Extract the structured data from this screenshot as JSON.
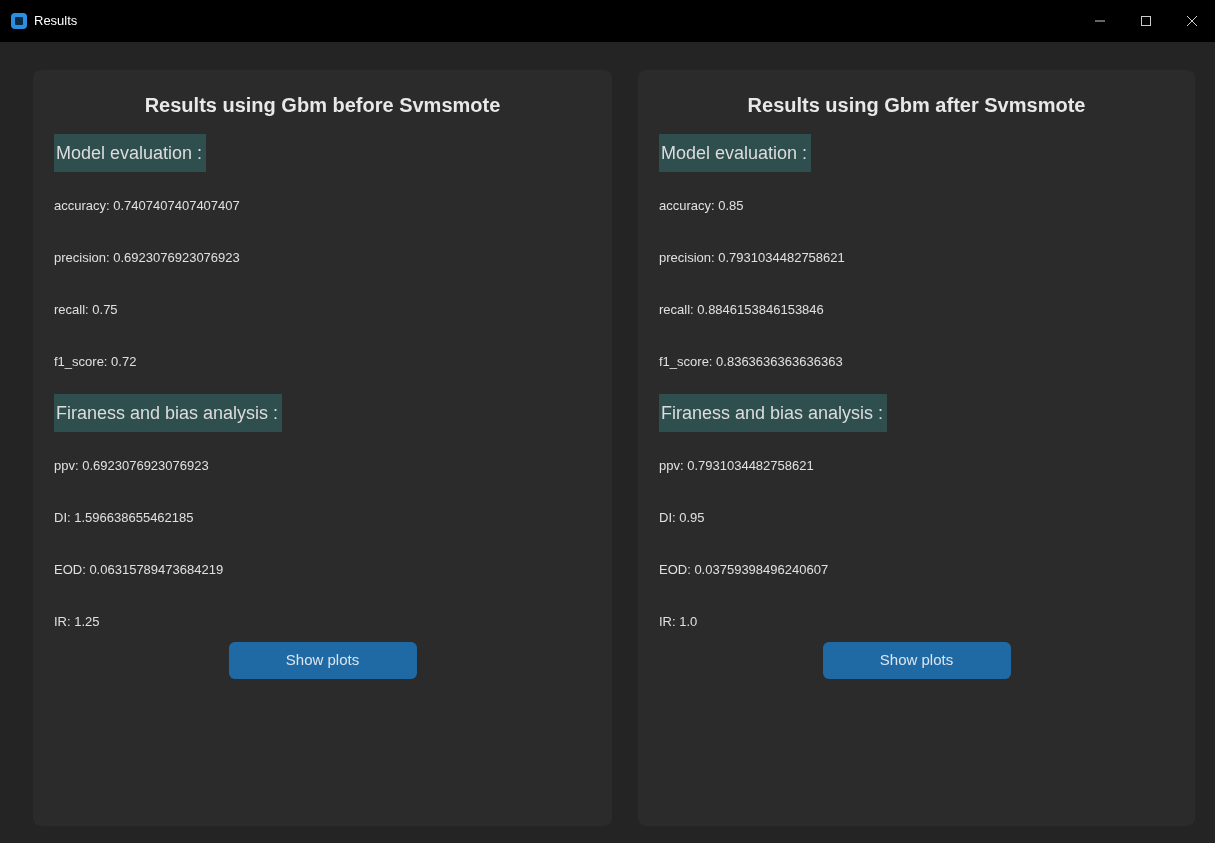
{
  "window": {
    "title": "Results"
  },
  "panels": [
    {
      "heading": "Results using Gbm before Svmsmote",
      "sections": [
        {
          "title": "Model evaluation :",
          "items": [
            "accuracy: 0.7407407407407407",
            "precision: 0.6923076923076923",
            "recall: 0.75",
            "f1_score: 0.72"
          ]
        },
        {
          "title": "Firaness and bias analysis :",
          "items": [
            "ppv: 0.6923076923076923",
            "DI: 1.596638655462185",
            "EOD: 0.06315789473684219",
            "IR: 1.25"
          ]
        }
      ],
      "button": "Show plots"
    },
    {
      "heading": "Results using Gbm after Svmsmote",
      "sections": [
        {
          "title": "Model evaluation :",
          "items": [
            "accuracy: 0.85",
            "precision: 0.7931034482758621",
            "recall: 0.8846153846153846",
            "f1_score: 0.8363636363636363"
          ]
        },
        {
          "title": "Firaness and bias analysis :",
          "items": [
            "ppv: 0.7931034482758621",
            "DI: 0.95",
            "EOD: 0.03759398496240607",
            "IR: 1.0"
          ]
        }
      ],
      "button": "Show plots"
    }
  ]
}
